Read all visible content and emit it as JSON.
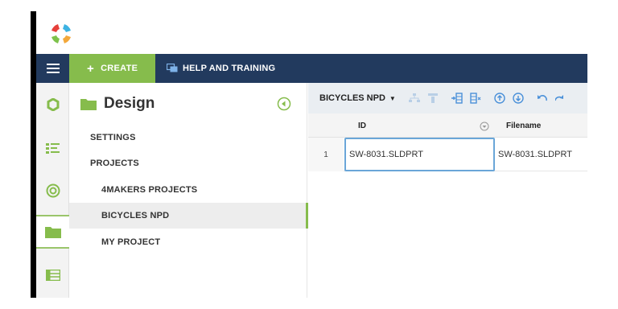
{
  "topbar": {
    "create_label": "CREATE",
    "help_label": "HELP AND TRAINING"
  },
  "panel": {
    "title": "Design",
    "items": [
      {
        "label": "SETTINGS"
      },
      {
        "label": "PROJECTS"
      },
      {
        "label": "4MAKERS PROJECTS"
      },
      {
        "label": "BICYCLES NPD"
      },
      {
        "label": "MY PROJECT"
      }
    ]
  },
  "grid": {
    "project_selector": "BICYCLES NPD",
    "columns": [
      "ID",
      "Filename"
    ],
    "rows": [
      {
        "num": "1",
        "id": "SW-8031.SLDPRT",
        "filename": "SW-8031.SLDPRT"
      }
    ]
  },
  "colors": {
    "topbar": "#223a5e",
    "create": "#86bc4c",
    "accent_green": "#86bc4c",
    "selection_blue": "#6aa6d8"
  }
}
